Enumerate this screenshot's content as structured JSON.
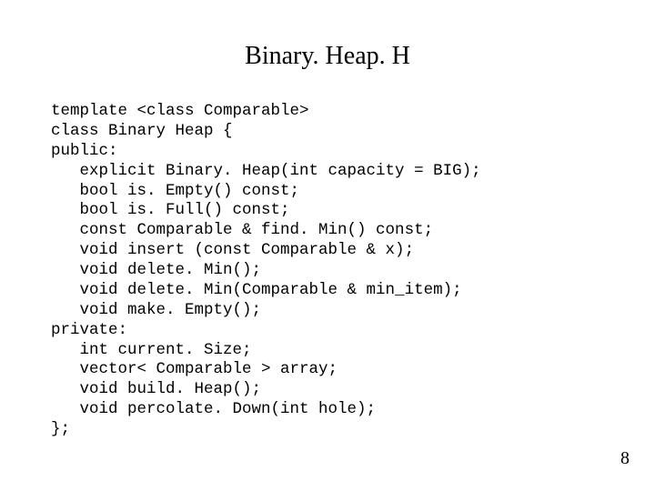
{
  "title": "Binary. Heap. H",
  "code_lines": [
    "template <class Comparable>",
    "class Binary Heap {",
    "public:",
    "   explicit Binary. Heap(int capacity = BIG);",
    "   bool is. Empty() const;",
    "   bool is. Full() const;",
    "   const Comparable & find. Min() const;",
    "   void insert (const Comparable & x);",
    "   void delete. Min();",
    "   void delete. Min(Comparable & min_item);",
    "   void make. Empty();",
    "private:",
    "   int current. Size;",
    "   vector< Comparable > array;",
    "   void build. Heap();",
    "   void percolate. Down(int hole);",
    "};"
  ],
  "page_number": "8"
}
